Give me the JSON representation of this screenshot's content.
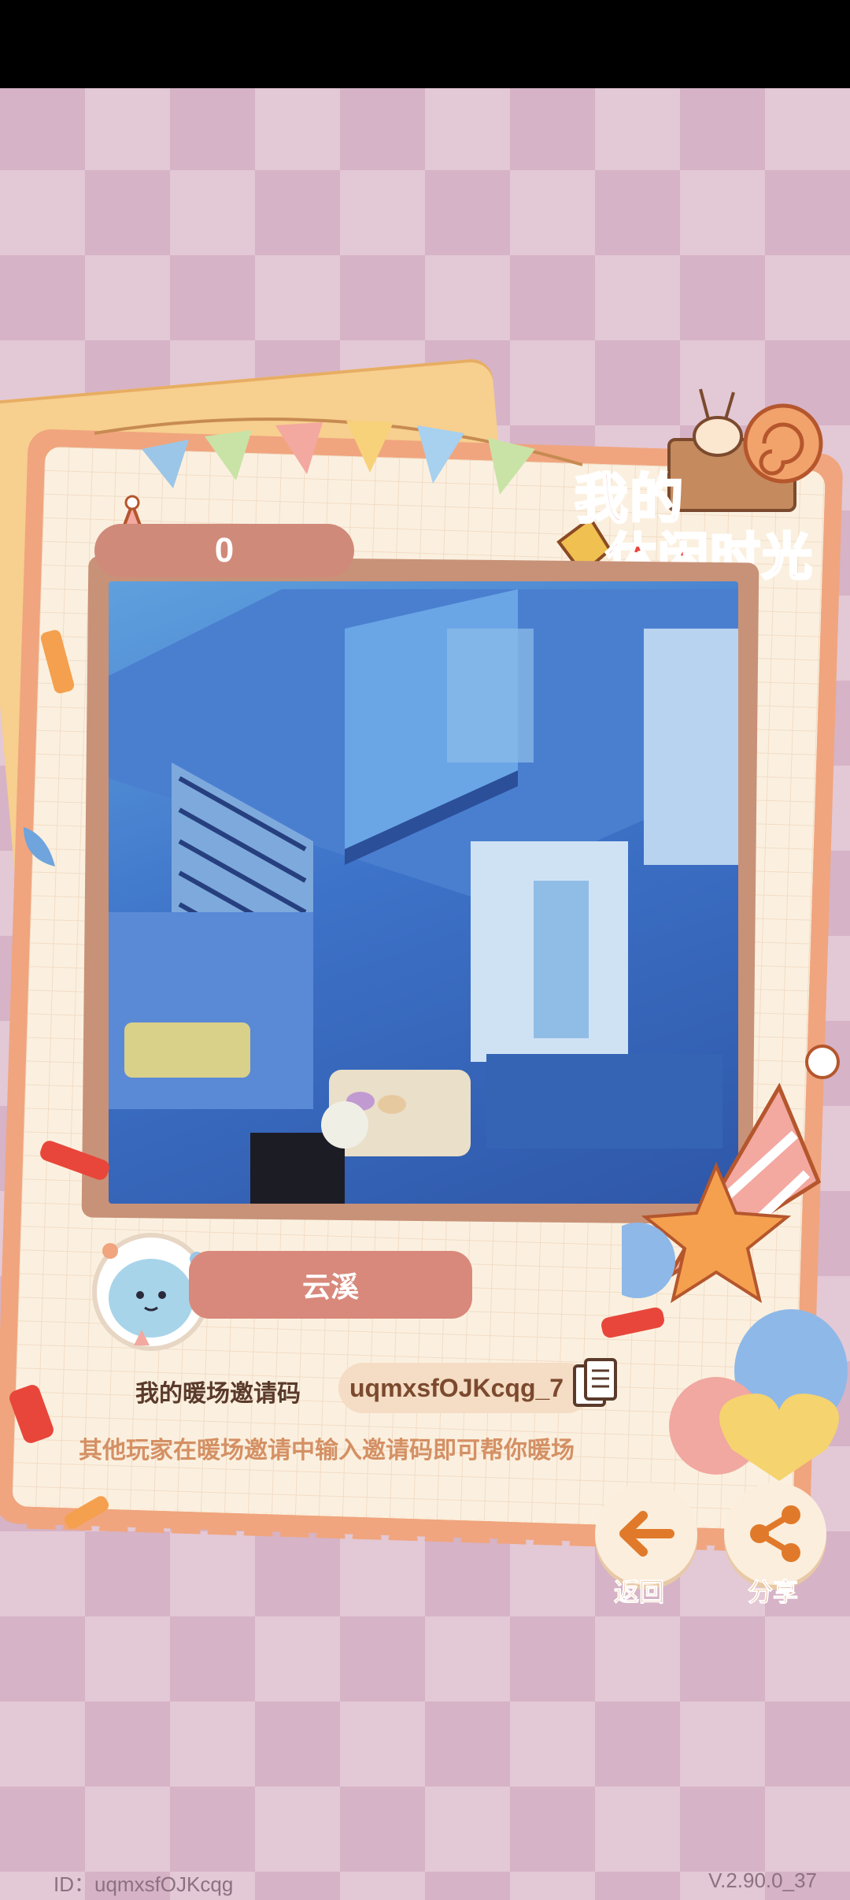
{
  "logo": {
    "line1": "我的",
    "line2": "休闲时光"
  },
  "score": "0",
  "player": {
    "name": "云溪"
  },
  "invite": {
    "label": "我的暖场邀请码",
    "code": "uqmxsfOJKcqg_7",
    "hint": "其他玩家在暖场邀请中输入邀请码即可帮你暖场"
  },
  "buttons": {
    "back": "返回",
    "share": "分享"
  },
  "footer": {
    "id": "ID：uqmxsfOJKcqg",
    "version": "V.2.90.0_37"
  },
  "colors": {
    "accent": "#d9772f",
    "plate": "#d8897b",
    "card_border": "#f0a57e"
  }
}
